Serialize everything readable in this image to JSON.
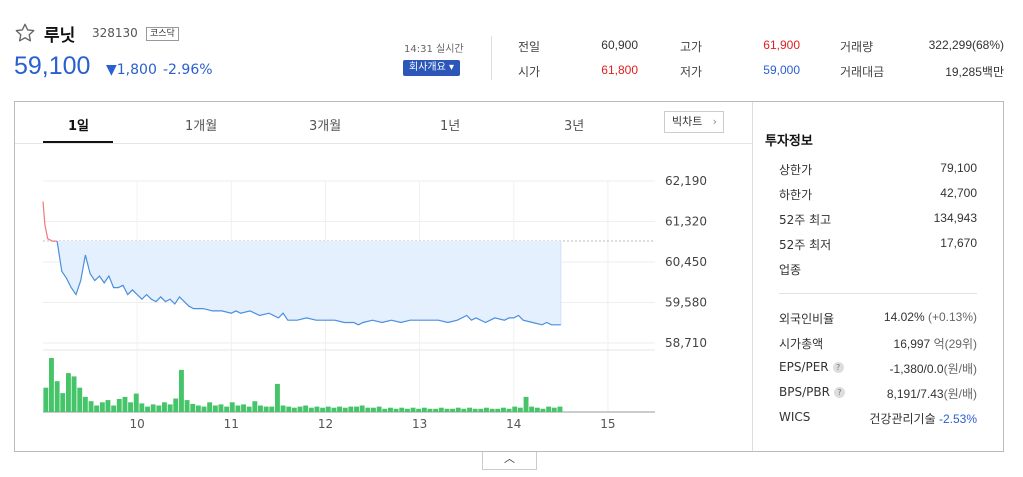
{
  "stock": {
    "name": "루닛",
    "code": "328130",
    "market": "코스닥",
    "price": "59,100",
    "change": "▼1,800",
    "change_pct": "-2.96%"
  },
  "realtime": {
    "time_label": "14:31 실시간",
    "company_button": "회사개요 ▾"
  },
  "summary": [
    {
      "label": "전일",
      "value": "60,900",
      "tone": "neutral"
    },
    {
      "label": "시가",
      "value": "61,800",
      "tone": "up"
    },
    {
      "label": "고가",
      "value": "61,900",
      "tone": "up"
    },
    {
      "label": "저가",
      "value": "59,000",
      "tone": "down"
    },
    {
      "label": "거래량",
      "value": "322,299(68%)",
      "tone": "neutral"
    },
    {
      "label": "거래대금",
      "value": "19,285백만",
      "tone": "neutral"
    }
  ],
  "tabs": [
    "1일",
    "1개월",
    "3개월",
    "1년",
    "3년"
  ],
  "bigchart_label": "빅차트",
  "chart_data": {
    "type": "line",
    "y_ticks": [
      "62,190",
      "61,320",
      "60,450",
      "59,580",
      "58,710"
    ],
    "x_ticks": [
      "10",
      "11",
      "12",
      "13",
      "14",
      "15"
    ],
    "ylim": [
      58710,
      62190
    ],
    "prev_close": 60900,
    "x_range": [
      9.0,
      15.5
    ],
    "price_series": [
      [
        9.0,
        61750
      ],
      [
        9.02,
        61250
      ],
      [
        9.05,
        60950
      ],
      [
        9.1,
        60900
      ],
      [
        9.15,
        60900
      ],
      [
        9.2,
        60250
      ],
      [
        9.25,
        60100
      ],
      [
        9.3,
        59900
      ],
      [
        9.35,
        59750
      ],
      [
        9.4,
        60050
      ],
      [
        9.45,
        60600
      ],
      [
        9.5,
        60200
      ],
      [
        9.55,
        60050
      ],
      [
        9.6,
        60150
      ],
      [
        9.65,
        60000
      ],
      [
        9.7,
        60150
      ],
      [
        9.75,
        59900
      ],
      [
        9.8,
        59900
      ],
      [
        9.85,
        59950
      ],
      [
        9.9,
        59750
      ],
      [
        9.95,
        59850
      ],
      [
        10.0,
        59750
      ],
      [
        10.05,
        59650
      ],
      [
        10.1,
        59750
      ],
      [
        10.15,
        59650
      ],
      [
        10.2,
        59600
      ],
      [
        10.25,
        59700
      ],
      [
        10.3,
        59600
      ],
      [
        10.35,
        59650
      ],
      [
        10.4,
        59550
      ],
      [
        10.45,
        59700
      ],
      [
        10.5,
        59600
      ],
      [
        10.55,
        59500
      ],
      [
        10.6,
        59450
      ],
      [
        10.7,
        59450
      ],
      [
        10.8,
        59400
      ],
      [
        10.9,
        59400
      ],
      [
        11.0,
        59350
      ],
      [
        11.05,
        59400
      ],
      [
        11.1,
        59350
      ],
      [
        11.2,
        59400
      ],
      [
        11.3,
        59300
      ],
      [
        11.4,
        59350
      ],
      [
        11.5,
        59250
      ],
      [
        11.55,
        59350
      ],
      [
        11.6,
        59200
      ],
      [
        11.7,
        59200
      ],
      [
        11.8,
        59250
      ],
      [
        11.9,
        59200
      ],
      [
        12.0,
        59200
      ],
      [
        12.1,
        59200
      ],
      [
        12.2,
        59150
      ],
      [
        12.3,
        59150
      ],
      [
        12.35,
        59100
      ],
      [
        12.4,
        59150
      ],
      [
        12.5,
        59200
      ],
      [
        12.6,
        59150
      ],
      [
        12.7,
        59200
      ],
      [
        12.8,
        59150
      ],
      [
        12.9,
        59200
      ],
      [
        13.0,
        59200
      ],
      [
        13.1,
        59200
      ],
      [
        13.2,
        59200
      ],
      [
        13.3,
        59150
      ],
      [
        13.4,
        59200
      ],
      [
        13.5,
        59300
      ],
      [
        13.55,
        59200
      ],
      [
        13.6,
        59250
      ],
      [
        13.7,
        59150
      ],
      [
        13.75,
        59200
      ],
      [
        13.8,
        59250
      ],
      [
        13.9,
        59200
      ],
      [
        13.95,
        59250
      ],
      [
        14.0,
        59250
      ],
      [
        14.05,
        59300
      ],
      [
        14.1,
        59200
      ],
      [
        14.2,
        59150
      ],
      [
        14.3,
        59100
      ],
      [
        14.35,
        59150
      ],
      [
        14.4,
        59100
      ],
      [
        14.45,
        59100
      ],
      [
        14.5,
        59100
      ]
    ],
    "volume_bars": [
      [
        9.03,
        0.45
      ],
      [
        9.09,
        1.0
      ],
      [
        9.15,
        0.57
      ],
      [
        9.21,
        0.35
      ],
      [
        9.27,
        0.72
      ],
      [
        9.33,
        0.66
      ],
      [
        9.39,
        0.45
      ],
      [
        9.45,
        0.28
      ],
      [
        9.51,
        0.2
      ],
      [
        9.57,
        0.12
      ],
      [
        9.63,
        0.18
      ],
      [
        9.69,
        0.22
      ],
      [
        9.75,
        0.12
      ],
      [
        9.81,
        0.24
      ],
      [
        9.87,
        0.28
      ],
      [
        9.93,
        0.18
      ],
      [
        9.99,
        0.34
      ],
      [
        10.05,
        0.16
      ],
      [
        10.11,
        0.1
      ],
      [
        10.17,
        0.14
      ],
      [
        10.23,
        0.12
      ],
      [
        10.29,
        0.18
      ],
      [
        10.35,
        0.14
      ],
      [
        10.41,
        0.25
      ],
      [
        10.47,
        0.78
      ],
      [
        10.53,
        0.22
      ],
      [
        10.59,
        0.15
      ],
      [
        10.65,
        0.12
      ],
      [
        10.71,
        0.1
      ],
      [
        10.77,
        0.18
      ],
      [
        10.83,
        0.12
      ],
      [
        10.89,
        0.14
      ],
      [
        10.95,
        0.1
      ],
      [
        11.01,
        0.18
      ],
      [
        11.07,
        0.12
      ],
      [
        11.13,
        0.14
      ],
      [
        11.19,
        0.1
      ],
      [
        11.25,
        0.2
      ],
      [
        11.31,
        0.12
      ],
      [
        11.37,
        0.1
      ],
      [
        11.43,
        0.1
      ],
      [
        11.49,
        0.52
      ],
      [
        11.55,
        0.12
      ],
      [
        11.61,
        0.1
      ],
      [
        11.67,
        0.08
      ],
      [
        11.73,
        0.1
      ],
      [
        11.79,
        0.12
      ],
      [
        11.85,
        0.08
      ],
      [
        11.91,
        0.1
      ],
      [
        11.97,
        0.08
      ],
      [
        12.03,
        0.1
      ],
      [
        12.09,
        0.08
      ],
      [
        12.15,
        0.1
      ],
      [
        12.21,
        0.08
      ],
      [
        12.27,
        0.1
      ],
      [
        12.33,
        0.1
      ],
      [
        12.39,
        0.12
      ],
      [
        12.45,
        0.08
      ],
      [
        12.51,
        0.08
      ],
      [
        12.57,
        0.1
      ],
      [
        12.63,
        0.06
      ],
      [
        12.69,
        0.08
      ],
      [
        12.75,
        0.06
      ],
      [
        12.81,
        0.08
      ],
      [
        12.87,
        0.06
      ],
      [
        12.93,
        0.08
      ],
      [
        12.99,
        0.06
      ],
      [
        13.05,
        0.08
      ],
      [
        13.11,
        0.06
      ],
      [
        13.17,
        0.06
      ],
      [
        13.23,
        0.08
      ],
      [
        13.29,
        0.06
      ],
      [
        13.35,
        0.06
      ],
      [
        13.41,
        0.08
      ],
      [
        13.47,
        0.06
      ],
      [
        13.53,
        0.08
      ],
      [
        13.59,
        0.06
      ],
      [
        13.65,
        0.06
      ],
      [
        13.71,
        0.08
      ],
      [
        13.77,
        0.06
      ],
      [
        13.83,
        0.06
      ],
      [
        13.89,
        0.08
      ],
      [
        13.95,
        0.06
      ],
      [
        14.01,
        0.1
      ],
      [
        14.07,
        0.08
      ],
      [
        14.13,
        0.28
      ],
      [
        14.19,
        0.1
      ],
      [
        14.25,
        0.08
      ],
      [
        14.31,
        0.06
      ],
      [
        14.37,
        0.1
      ],
      [
        14.43,
        0.08
      ],
      [
        14.49,
        0.1
      ]
    ]
  },
  "invest_info": {
    "title": "투자정보",
    "rows": [
      {
        "label": "상한가",
        "value": "79,100",
        "tone": "up"
      },
      {
        "label": "하한가",
        "value": "42,700",
        "tone": "down"
      },
      {
        "label": "52주 최고",
        "value": "134,943",
        "tone": "neutral"
      },
      {
        "label": "52주 최저",
        "value": "17,670",
        "tone": "neutral"
      },
      {
        "label": "업종",
        "value": "",
        "tone": "neutral"
      }
    ],
    "rows2": [
      {
        "label": "외국인비율",
        "value": "14.02%",
        "sub": "(+0.13%)",
        "help": false
      },
      {
        "label": "시가총액",
        "value": "16,997",
        "sub": "억(29위)",
        "help": false
      },
      {
        "label": "EPS/PER",
        "value": "-1,380/0.0",
        "sub": "(원/배)",
        "help": true
      },
      {
        "label": "BPS/PBR",
        "value": "8,191/7.43",
        "sub": "(원/배)",
        "help": true
      },
      {
        "label": "WICS",
        "value": "건강관리기술",
        "sub": "-2.53%",
        "help": false
      }
    ]
  },
  "colors": {
    "up": "#e02020",
    "down": "#2a5fd0",
    "line": "#4a8fe0",
    "fill": "#e4f0fd",
    "volume": "#46c46a"
  }
}
